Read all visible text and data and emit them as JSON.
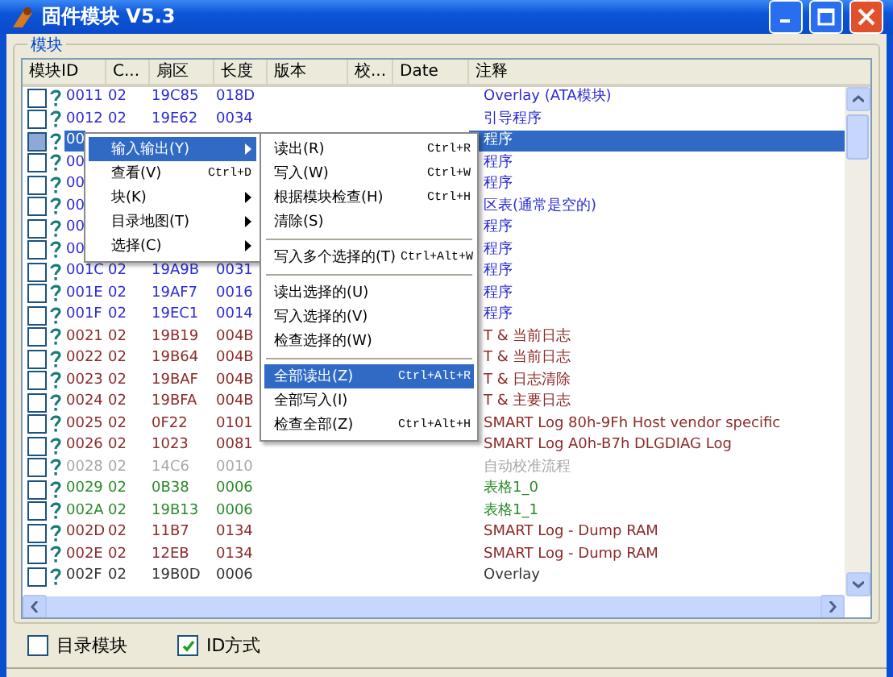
{
  "window": {
    "title": "固件模块 V5.3"
  },
  "group": {
    "label": "模块"
  },
  "columns": [
    "模块ID",
    "C...",
    "扇区",
    "长度",
    "版本",
    "校...",
    "Date",
    "注释"
  ],
  "rows": [
    {
      "checked": false,
      "selected": false,
      "color": "#2b2bd6",
      "id": "0011",
      "c": "02",
      "sector": "19C85",
      "length": "018D",
      "comment": "Overlay (ATA模块)"
    },
    {
      "checked": false,
      "selected": false,
      "color": "#2b2bd6",
      "id": "0012",
      "c": "02",
      "sector": "19E62",
      "length": "0034",
      "comment": "引导程序"
    },
    {
      "checked": false,
      "selected": true,
      "id": "00",
      "comment": "程序"
    },
    {
      "checked": false,
      "selected": false,
      "color": "#2b2bd6",
      "id": "00",
      "comment": "程序"
    },
    {
      "checked": false,
      "selected": false,
      "color": "#2b2bd6",
      "id": "00",
      "comment": "程序"
    },
    {
      "checked": false,
      "selected": false,
      "color": "#2b2bd6",
      "id": "00",
      "comment": "区表(通常是空的)"
    },
    {
      "checked": false,
      "selected": false,
      "color": "#2b2bd6",
      "id": "00",
      "comment": "程序"
    },
    {
      "checked": false,
      "selected": false,
      "color": "#2b2bd6",
      "id": "00",
      "comment": "程序"
    },
    {
      "checked": false,
      "selected": false,
      "color": "#2b2bd6",
      "id": "001C",
      "c": "02",
      "sector": "19A9B",
      "length": "0031",
      "comment": "程序"
    },
    {
      "checked": false,
      "selected": false,
      "color": "#2b2bd6",
      "id": "001E",
      "c": "02",
      "sector": "19AF7",
      "length": "0016",
      "comment": "程序"
    },
    {
      "checked": false,
      "selected": false,
      "color": "#2b2bd6",
      "id": "001F",
      "c": "02",
      "sector": "19EC1",
      "length": "0014",
      "comment": "程序"
    },
    {
      "checked": false,
      "selected": false,
      "color": "#8c2a2a",
      "id": "0021",
      "c": "02",
      "sector": "19B19",
      "length": "004B",
      "comment": "T & 当前日志"
    },
    {
      "checked": false,
      "selected": false,
      "color": "#8c2a2a",
      "id": "0022",
      "c": "02",
      "sector": "19B64",
      "length": "004B",
      "comment": "T & 当前日志"
    },
    {
      "checked": false,
      "selected": false,
      "color": "#8c2a2a",
      "id": "0023",
      "c": "02",
      "sector": "19BAF",
      "length": "004B",
      "comment": "T & 日志清除"
    },
    {
      "checked": false,
      "selected": false,
      "color": "#8c2a2a",
      "id": "0024",
      "c": "02",
      "sector": "19BFA",
      "length": "004B",
      "comment": "T & 主要日志"
    },
    {
      "checked": false,
      "selected": false,
      "color": "#8c2a2a",
      "id": "0025",
      "c": "02",
      "sector": "0F22",
      "length": "0101",
      "comment": "SMART Log 80h-9Fh Host vendor specific"
    },
    {
      "checked": false,
      "selected": false,
      "color": "#8c2a2a",
      "id": "0026",
      "c": "02",
      "sector": "1023",
      "length": "0081",
      "comment": "SMART Log A0h-B7h DLGDIAG Log"
    },
    {
      "checked": false,
      "selected": false,
      "color": "#a8a8a8",
      "id": "0028",
      "c": "02",
      "sector": "14C6",
      "length": "0010",
      "comment": "自动校准流程"
    },
    {
      "checked": false,
      "selected": false,
      "color": "#2a8a2a",
      "id": "0029",
      "c": "02",
      "sector": "0B38",
      "length": "0006",
      "comment": "表格1_0"
    },
    {
      "checked": false,
      "selected": false,
      "color": "#2a8a2a",
      "id": "002A",
      "c": "02",
      "sector": "19B13",
      "length": "0006",
      "comment": "表格1_1"
    },
    {
      "checked": false,
      "selected": false,
      "color": "#8c2a2a",
      "id": "002D",
      "c": "02",
      "sector": "11B7",
      "length": "0134",
      "comment": "SMART Log - Dump RAM"
    },
    {
      "checked": false,
      "selected": false,
      "color": "#8c2a2a",
      "id": "002E",
      "c": "02",
      "sector": "12EB",
      "length": "0134",
      "comment": "SMART Log - Dump RAM"
    },
    {
      "checked": false,
      "selected": false,
      "color": "#333333",
      "id": "002F",
      "c": "02",
      "sector": "19B0D",
      "length": "0006",
      "comment": "Overlay"
    }
  ],
  "context_menu": [
    {
      "label": "输入输出(Y)",
      "has_submenu": true,
      "selected": true
    },
    {
      "label": "查看(V)",
      "shortcut": "Ctrl+D",
      "has_submenu": false,
      "selected": false
    },
    {
      "label": "块(K)",
      "has_submenu": true,
      "selected": false
    },
    {
      "label": "目录地图(T)",
      "has_submenu": true,
      "selected": false
    },
    {
      "label": "选择(C)",
      "has_submenu": true,
      "selected": false
    }
  ],
  "submenu": [
    {
      "kind": "item",
      "label": "读出(R)",
      "shortcut": "Ctrl+R",
      "selected": false
    },
    {
      "kind": "item",
      "label": "写入(W)",
      "shortcut": "Ctrl+W",
      "selected": false
    },
    {
      "kind": "item",
      "label": "根据模块检查(H)",
      "shortcut": "Ctrl+H",
      "selected": false
    },
    {
      "kind": "item",
      "label": "清除(S)",
      "selected": false
    },
    {
      "kind": "separator"
    },
    {
      "kind": "item",
      "label": "写入多个选择的(T)",
      "shortcut": "Ctrl+Alt+W",
      "selected": false
    },
    {
      "kind": "separator"
    },
    {
      "kind": "item",
      "label": "读出选择的(U)",
      "selected": false
    },
    {
      "kind": "item",
      "label": "写入选择的(V)",
      "selected": false
    },
    {
      "kind": "item",
      "label": "检查选择的(W)",
      "selected": false
    },
    {
      "kind": "separator"
    },
    {
      "kind": "item",
      "label": "全部读出(Z)",
      "shortcut": "Ctrl+Alt+R",
      "selected": true
    },
    {
      "kind": "item",
      "label": "全部写入(I)",
      "selected": false
    },
    {
      "kind": "item",
      "label": "检查全部(Z)",
      "shortcut": "Ctrl+Alt+H",
      "selected": false
    }
  ],
  "options": [
    {
      "label": "目录模块",
      "checked": false
    },
    {
      "label": "ID方式",
      "checked": true
    }
  ]
}
